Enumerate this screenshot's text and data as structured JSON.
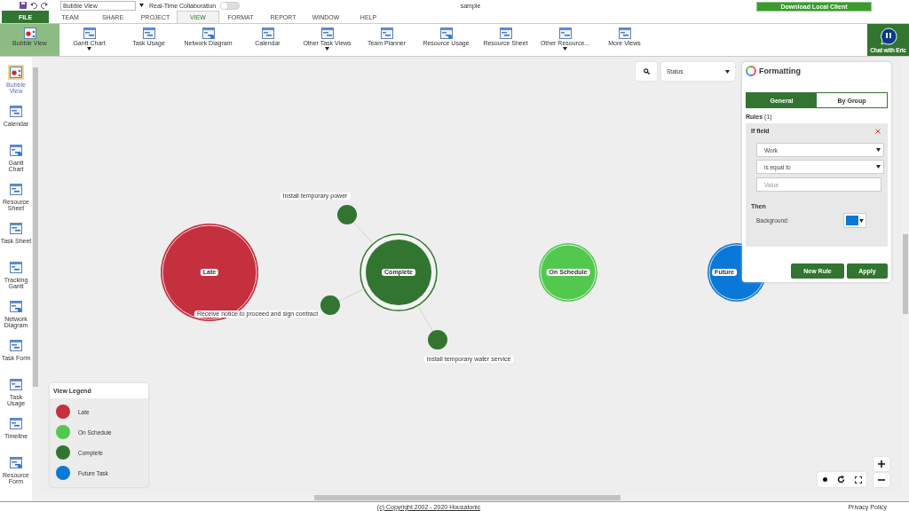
{
  "quick_access": {
    "view_field": "Bubble View",
    "collaboration_label": "Real-Time Collaboration",
    "collaboration_on": false,
    "document_title": "sample",
    "download_button": "Download Local Client"
  },
  "menu_tabs": [
    {
      "label": "FILE",
      "kind": "file",
      "selected": false
    },
    {
      "label": "TEAM",
      "kind": "tab",
      "selected": false
    },
    {
      "label": "SHARE",
      "kind": "tab",
      "selected": false
    },
    {
      "label": "PROJECT",
      "kind": "tab",
      "selected": false
    },
    {
      "label": "VIEW",
      "kind": "tab",
      "selected": true
    },
    {
      "label": "FORMAT",
      "kind": "tab",
      "selected": false
    },
    {
      "label": "REPORT",
      "kind": "tab",
      "selected": false
    },
    {
      "label": "WINDOW",
      "kind": "tab",
      "selected": false
    },
    {
      "label": "HELP",
      "kind": "tab",
      "selected": false
    }
  ],
  "ribbon": [
    {
      "label": "Bubble View",
      "selected": true,
      "has_menu": false
    },
    {
      "label": "Gantt Chart",
      "selected": false,
      "has_menu": true
    },
    {
      "label": "Task Usage",
      "selected": false,
      "has_menu": false
    },
    {
      "label": "Network Diagram",
      "selected": false,
      "has_menu": false
    },
    {
      "label": "Calendar",
      "selected": false,
      "has_menu": false
    },
    {
      "label": "Other Task Views",
      "selected": false,
      "has_menu": true
    },
    {
      "label": "Team Planner",
      "selected": false,
      "has_menu": false
    },
    {
      "label": "Resource Usage",
      "selected": false,
      "has_menu": false
    },
    {
      "label": "Resource Sheet",
      "selected": false,
      "has_menu": false
    },
    {
      "label": "Other Resource...",
      "selected": false,
      "has_menu": true
    },
    {
      "label": "More Views",
      "selected": false,
      "has_menu": false
    }
  ],
  "chat_button": "Chat with Eric",
  "sidebar": [
    {
      "label": "Bubble View",
      "selected": true
    },
    {
      "label": "Calendar",
      "selected": false
    },
    {
      "label": "Gantt Chart",
      "selected": false
    },
    {
      "label": "Resource Sheet",
      "selected": false
    },
    {
      "label": "Task Sheet",
      "selected": false
    },
    {
      "label": "Tracking Gantt",
      "selected": false
    },
    {
      "label": "Network Diagram",
      "selected": false
    },
    {
      "label": "Task Form",
      "selected": false
    },
    {
      "label": "Task Usage",
      "selected": false
    },
    {
      "label": "Timeline",
      "selected": false
    },
    {
      "label": "Resource Form",
      "selected": false
    }
  ],
  "canvas": {
    "group_by": "Status",
    "bubbles": [
      {
        "label": "Late",
        "color": "#c5303f"
      },
      {
        "label": "Complete",
        "color": "#327530",
        "tasks": [
          {
            "label": "Install temporary power"
          },
          {
            "label": "Receive notice to proceed and sign contract"
          },
          {
            "label": "Install temporary water service"
          }
        ]
      },
      {
        "label": "On Schedule",
        "color": "#52c84f"
      },
      {
        "label": "Future",
        "color": "#0a78d7"
      }
    ]
  },
  "legend": {
    "title": "View Legend",
    "items": [
      {
        "label": "Late",
        "color": "#c5303f"
      },
      {
        "label": "On Schedule",
        "color": "#52c84f"
      },
      {
        "label": "Complete",
        "color": "#327530"
      },
      {
        "label": "Future Task",
        "color": "#0a78d7"
      }
    ]
  },
  "formatting": {
    "title": "Formatting",
    "tabs": [
      {
        "label": "General",
        "selected": true
      },
      {
        "label": "By Group",
        "selected": false
      }
    ],
    "rules_label": "Rules",
    "rules_count": "(1)",
    "rule": {
      "heading": "If field",
      "field": "Work",
      "operator": "is equal to",
      "value_placeholder": "Value",
      "then_label": "Then",
      "background_label": "Background:"
    },
    "buttons": [
      "New Rule",
      "Apply"
    ]
  },
  "footer": {
    "copyright": "(c) Copyright 2002 - 2020 Housatonic",
    "privacy": "Privacy Policy"
  }
}
